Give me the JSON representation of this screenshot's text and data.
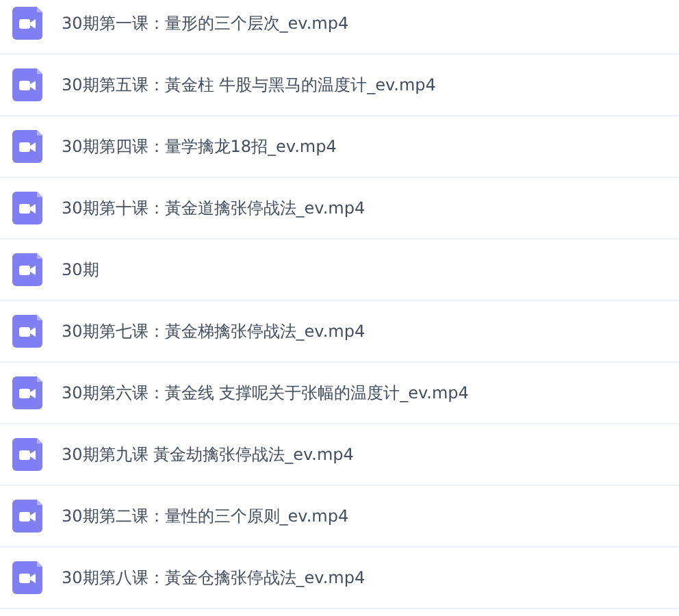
{
  "files": [
    {
      "name": "30期第一课：量形的三个层次_ev.mp4"
    },
    {
      "name": "30期第五课：黃金柱 牛股与黑马的温度计_ev.mp4"
    },
    {
      "name": "30期第四课：量学擒龙18招_ev.mp4"
    },
    {
      "name": "30期第十课：黃金道擒张停战法_ev.mp4"
    },
    {
      "name": "30期"
    },
    {
      "name": "30期第七课：黃金梯擒张停战法_ev.mp4"
    },
    {
      "name": "30期第六课：黃金线 支撑呢关于张幅的温度计_ev.mp4"
    },
    {
      "name": "30期第九课 黃金劫擒张停战法_ev.mp4"
    },
    {
      "name": "30期第二课：量性的三个原则_ev.mp4"
    },
    {
      "name": "30期第八课：黃金仓擒张停战法_ev.mp4"
    }
  ]
}
